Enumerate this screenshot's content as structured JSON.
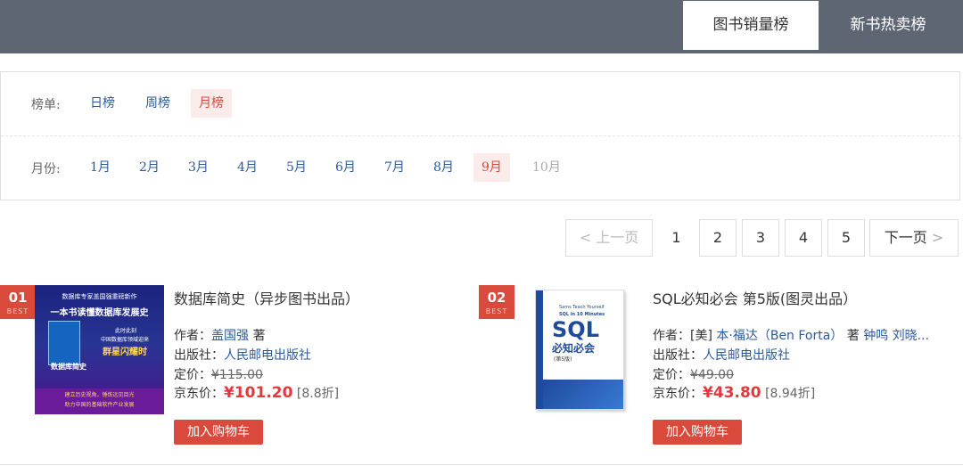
{
  "tabs": {
    "sales": "图书销量榜",
    "new": "新书热卖榜"
  },
  "filters": {
    "list_label": "榜单:",
    "list_options": [
      "日榜",
      "周榜",
      "月榜"
    ],
    "month_label": "月份:",
    "months": [
      "1月",
      "2月",
      "3月",
      "4月",
      "5月",
      "6月",
      "7月",
      "8月",
      "9月",
      "10月"
    ]
  },
  "pager": {
    "prev": "< 上一页",
    "pages": [
      "1",
      "2",
      "3",
      "4",
      "5"
    ],
    "next": "下一页",
    "next_arrow": ">"
  },
  "books": [
    {
      "rank": "01",
      "badge": "BEST",
      "title": "数据库简史（异步图书出品）",
      "author_label": "作者：",
      "author": "盖国强",
      "author_suffix": "著",
      "publisher_label": "出版社：",
      "publisher": "人民邮电出版社",
      "list_price_label": "定价：",
      "list_price": "¥115.00",
      "jd_price_label": "京东价：",
      "jd_price": "¥101.20",
      "discount": "[8.8折]",
      "cart": "加入购物车",
      "cover": {
        "top": "数据库专家盖国强重磅新作",
        "main": "一本书读懂数据库发展史",
        "sub1": "此时此刻",
        "sub2": "中国数据库领域迎来",
        "highlight": "群星闪耀时",
        "title": "数据库简史",
        "bottom1": "建立历史视角，锤炼远见目光",
        "bottom2": "助力中国的基础软件产业发展"
      }
    },
    {
      "rank": "02",
      "badge": "BEST",
      "title": "SQL必知必会 第5版(图灵出品）",
      "author_label": "作者：",
      "author_prefix": "[美]",
      "author": "本·福达（Ben Forta）",
      "author_suffix": "著",
      "author2": "钟鸣",
      "author3": "刘晓...",
      "publisher_label": "出版社：",
      "publisher": "人民邮电出版社",
      "list_price_label": "定价：",
      "list_price": "¥49.00",
      "jd_price_label": "京东价：",
      "jd_price": "¥43.80",
      "discount": "[8.94折]",
      "cart": "加入购物车",
      "cover": {
        "small": "Sams Teach Yourself",
        "en": "SQL in 10 Minutes",
        "big": "SQL",
        "cn": "必知必会",
        "edition": "(第5版)"
      }
    }
  ],
  "colors": {
    "topbar": "#5e6674",
    "accent": "#d94a3d",
    "link": "#2b5a9a",
    "price": "#e3393c"
  }
}
